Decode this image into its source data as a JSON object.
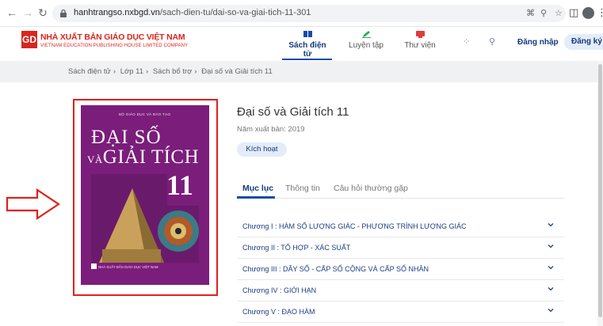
{
  "browser": {
    "url_host": "hanhtrangso.nxbgd.vn",
    "url_path": "/sach-dien-tu/dai-so-va-giai-tich-11-301"
  },
  "site": {
    "logo_mark": "GD",
    "logo_title": "NHÀ XUẤT BẢN GIÁO DỤC VIỆT NAM",
    "logo_subtitle": "VIETNAM EDUCATION PUBLISHING HOUSE LIMITED COMPANY",
    "tabs": [
      {
        "label": "Sách điện tử",
        "icon": "book-icon"
      },
      {
        "label": "Luyện tập",
        "icon": "pencil-icon"
      },
      {
        "label": "Thư viện",
        "icon": "library-icon"
      }
    ],
    "login_label": "Đăng nhập",
    "register_label": "Đăng ký"
  },
  "breadcrumb": [
    "Sách điện tử",
    "Lớp 11",
    "Sách bổ trợ",
    "Đại số và Giải tích 11"
  ],
  "book": {
    "title": "Đại số và Giải tích 11",
    "year": "Năm xuất bản: 2019",
    "activate_label": "Kích hoạt",
    "cover": {
      "publisher_top": "BỘ GIÁO DỤC VÀ ĐÀO TẠO",
      "title_line1": "ĐẠI SỐ",
      "title_va": "VÀ",
      "title_line2": "GIẢI TÍCH",
      "grade": "11",
      "publisher_bottom": "NHÀ XUẤT BẢN GIÁO DỤC VIỆT NAM",
      "color": "#7b1d7a"
    }
  },
  "content_tabs": [
    "Mục lục",
    "Thông tin",
    "Câu hỏi thường gặp"
  ],
  "chapters": [
    "Chương I :  HÀM SỐ LƯỢNG GIÁC - PHƯƠNG TRÌNH LƯỢNG GIÁC",
    "Chương II :  TỔ HỢP - XÁC SUẤT",
    "Chương III :  DÃY SỐ - CẤP SỐ CỘNG VÀ CẤP SỐ NHÂN",
    "Chương IV :  GIỚI HẠN",
    "Chương V :  ĐẠO HÀM"
  ],
  "colors": {
    "accent": "#1a4ba8",
    "highlight": "#e2201c",
    "brand": "#d9261c"
  }
}
